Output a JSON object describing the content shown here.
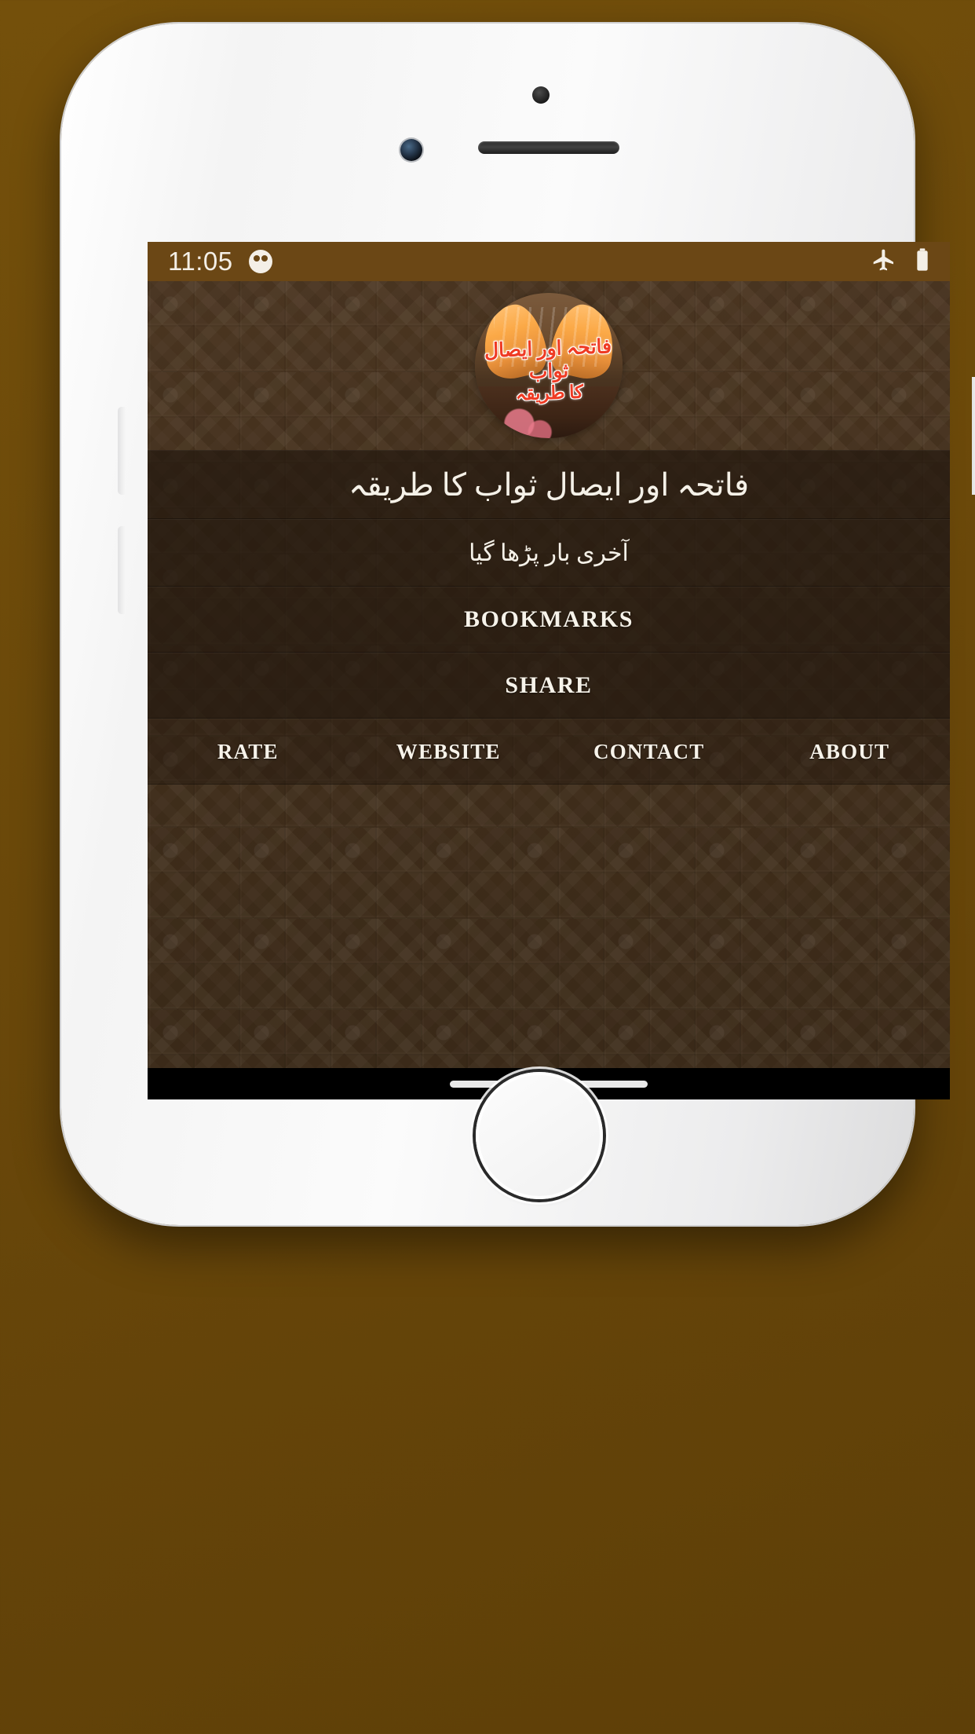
{
  "status_bar": {
    "time": "11:05",
    "notification_icon": "cat-face-notification-icon",
    "airplane_icon": "airplane-mode-icon",
    "battery_icon": "battery-full-icon",
    "background_color": "#6b4715",
    "text_color": "#f4efe6"
  },
  "app": {
    "logo": {
      "icon_name": "praying-hands-logo",
      "text_line1": "فاتحہ اور ایصال ثواب",
      "text_line2": "کا طریقہ",
      "text_color": "#ef3b24"
    },
    "title": "فاتحہ اور ایصال ثواب کا طریقہ",
    "last_read_label": "آخری بار پڑھا گیا",
    "menu": [
      {
        "id": "bookmarks",
        "label": "BOOKMARKS"
      },
      {
        "id": "share",
        "label": "SHARE"
      }
    ],
    "quick_actions": [
      {
        "id": "rate",
        "label": "RATE"
      },
      {
        "id": "website",
        "label": "WEBSITE"
      },
      {
        "id": "contact",
        "label": "CONTACT"
      },
      {
        "id": "about",
        "label": "ABOUT"
      }
    ],
    "theme": {
      "background_color": "#46331f",
      "panel_color": "#241a0f",
      "text_color": "#f7f3ea",
      "accent_color": "#6b4715"
    }
  },
  "device": {
    "body_color": "#f6f6f6",
    "home_button": "home-button",
    "home_indicator": "home-indicator"
  }
}
